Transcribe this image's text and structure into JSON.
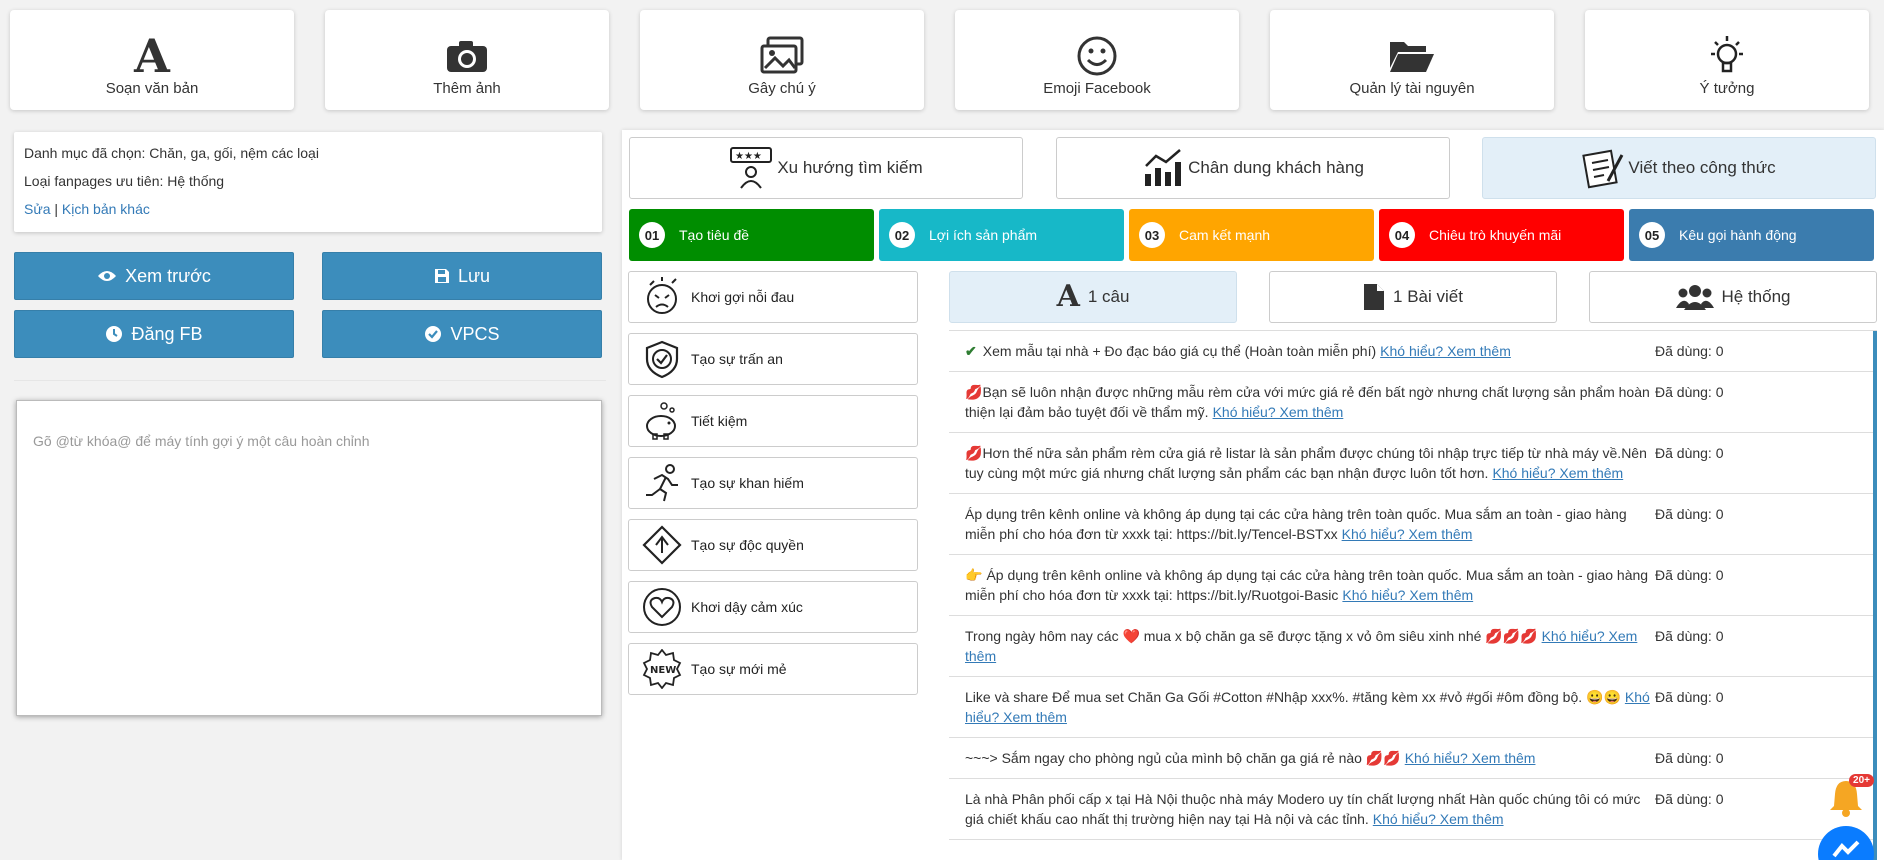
{
  "toolbar": [
    {
      "label": "Soạn văn bản",
      "icon": "text-a-icon"
    },
    {
      "label": "Thêm ảnh",
      "icon": "camera-icon"
    },
    {
      "label": "Gây chú ý",
      "icon": "images-icon"
    },
    {
      "label": "Emoji Facebook",
      "icon": "smile-icon"
    },
    {
      "label": "Quản lý tài nguyên",
      "icon": "folder-open-icon"
    },
    {
      "label": "Ý tưởng",
      "icon": "lightbulb-icon"
    }
  ],
  "info": {
    "category_line": "Danh mục đã chọn: Chăn, ga, gối, nệm các loại",
    "fanpage_line": "Loại fanpages ưu tiên: Hệ thống",
    "edit_link": "Sửa",
    "divider": "|",
    "other_link": "Kịch bản khác"
  },
  "actions": {
    "preview": "Xem trước",
    "save": "Lưu",
    "post_fb": "Đăng FB",
    "vpcs": "VPCS"
  },
  "editor": {
    "placeholder": "Gõ @từ khóa@ để máy tính gợi ý một câu hoàn chỉnh"
  },
  "tabs": [
    {
      "label": "Xu hướng tìm kiếm",
      "active": false
    },
    {
      "label": "Chân dung khách hàng",
      "active": false
    },
    {
      "label": "Viết theo công thức",
      "active": true
    }
  ],
  "steps": [
    {
      "num": "01",
      "label": "Tạo tiêu đề",
      "color": "#008d00"
    },
    {
      "num": "02",
      "label": "Lợi ích sản phẩm",
      "color": "#17b8c8"
    },
    {
      "num": "03",
      "label": "Cam kết mạnh",
      "color": "#ffa500"
    },
    {
      "num": "04",
      "label": "Chiêu trò khuyến mãi",
      "color": "#ff0000"
    },
    {
      "num": "05",
      "label": "Kêu gọi hành động",
      "color": "#3b7cae"
    }
  ],
  "categories": [
    {
      "label": "Khơi gợi nỗi đau",
      "icon": "pain-face-icon"
    },
    {
      "label": "Tạo sự trấn an",
      "icon": "shield-check-icon"
    },
    {
      "label": "Tiết kiệm",
      "icon": "piggy-bank-icon"
    },
    {
      "label": "Tạo sự khan hiếm",
      "icon": "running-man-icon"
    },
    {
      "label": "Tạo sự độc quyền",
      "icon": "arrow-diamond-icon"
    },
    {
      "label": "Khơi dậy cảm xúc",
      "icon": "heart-icon"
    },
    {
      "label": "Tạo sự mới mẻ",
      "icon": "new-badge-icon"
    }
  ],
  "modes": [
    {
      "label": "1 câu",
      "active": true
    },
    {
      "label": "1 Bài viết",
      "active": false
    },
    {
      "label": "Hệ thống",
      "active": false
    }
  ],
  "link_text": "Khó hiểu? Xem thêm",
  "used_label": "Đã dùng: 0",
  "sentences": [
    {
      "prefix": "✔",
      "text": "Xem mẫu tại nhà + Đo đạc báo giá cụ thể (Hoàn toàn miễn phí)"
    },
    {
      "prefix": "💋",
      "text": "Bạn sẽ luôn nhận được những mẫu rèm cửa với mức giá rẻ đến bất ngờ nhưng chất lượng sản phẩm hoàn thiện lại đảm bảo tuyệt đối về thẩm mỹ."
    },
    {
      "prefix": "💋",
      "text": "Hơn thế nữa sản phẩm rèm cửa giá rẻ listar là sản phẩm được chúng tôi nhập trực tiếp từ nhà máy về.Nên tuy cùng một mức giá nhưng chất lượng sản phẩm các bạn nhận được luôn tốt hơn."
    },
    {
      "prefix": "",
      "text": "Áp dụng trên kênh online và không áp dụng tại các cửa hàng trên toàn quốc. Mua sắm an toàn - giao hàng miễn phí cho hóa đơn từ xxxk tại: https://bit.ly/Tencel-BSTxx"
    },
    {
      "prefix": "👉",
      "text": "Áp dụng trên kênh online và không áp dụng tại các cửa hàng trên toàn quốc. Mua sắm an toàn - giao hàng miễn phí cho hóa đơn từ xxxk tại: https://bit.ly/Ruotgoi-Basic"
    },
    {
      "prefix": "",
      "text": "Trong ngày hôm nay các ❤️ mua x bộ chăn ga sẽ được tặng x vỏ ôm siêu xinh nhé 💋💋💋"
    },
    {
      "prefix": "",
      "text": "Like và share Để mua set Chăn Ga Gối #Cotton #Nhập xxx%. #tăng kèm xx #vỏ #gối #ôm đồng bộ. 😀😀"
    },
    {
      "prefix": "",
      "text": "~~~> Sắm ngay cho phòng ngủ của mình bộ chăn ga giá rẻ nào 💋💋"
    },
    {
      "prefix": "",
      "text": "Là nhà Phân phối cấp x tại Hà Nội thuộc nhà máy Modero uy tín chất lượng nhất Hàn quốc chúng tôi có mức giá chiết khấu cao nhất thị trường hiện nay tại Hà nội và các tỉnh."
    }
  ],
  "notifications": {
    "badge": "20+"
  }
}
